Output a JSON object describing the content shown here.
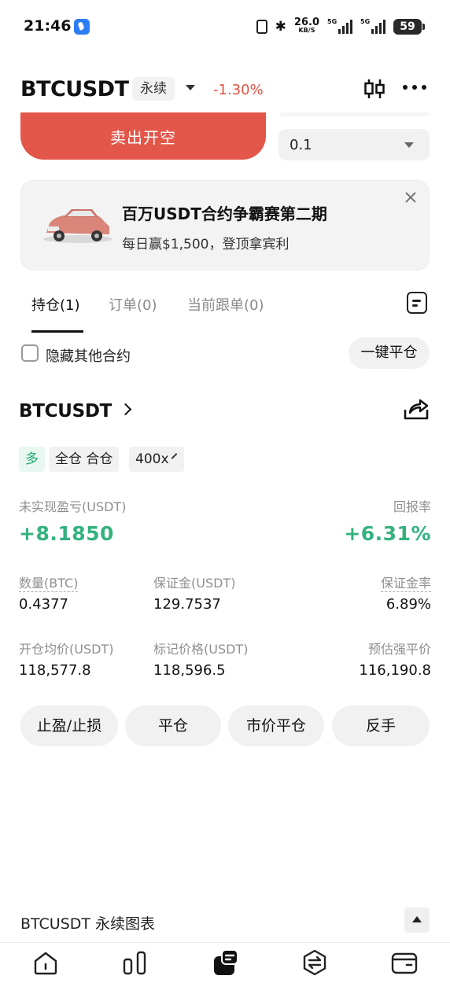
{
  "status_bar": {
    "time": "21:46",
    "net_speed_value": "26.0",
    "net_speed_unit": "KB/S",
    "sig1_type": "5G",
    "sig2_type": "5G",
    "battery": "59"
  },
  "header": {
    "symbol": "BTCUSDT",
    "contract_type": "永续",
    "change": "-1.30%"
  },
  "order": {
    "sell_label": "卖出开空",
    "quantity": "0.1"
  },
  "banner": {
    "title": "百万USDT合约争霸赛第二期",
    "subtitle": "每日赢$1,500，登顶拿宾利"
  },
  "tabs": [
    {
      "label": "持仓(1)"
    },
    {
      "label": "订单(0)"
    },
    {
      "label": "当前跟单(0)"
    }
  ],
  "filter": {
    "hide_others_label": "隐藏其他合约",
    "close_all_label": "一键平仓"
  },
  "position": {
    "symbol": "BTCUSDT",
    "side": "多",
    "margin_mode": "全仓 合仓",
    "leverage": "400x",
    "unrealized_pnl_label": "未实现盈亏(USDT)",
    "unrealized_pnl": "+8.1850",
    "roe_label": "回报率",
    "roe": "+6.31%",
    "size_label": "数量(BTC)",
    "size": "0.4377",
    "margin_label": "保证金(USDT)",
    "margin": "129.7537",
    "margin_ratio_label": "保证金率",
    "margin_ratio": "6.89%",
    "entry_label": "开仓均价(USDT)",
    "entry": "118,577.8",
    "mark_label": "标记价格(USDT)",
    "mark": "118,596.5",
    "liq_label": "预估强平价",
    "liq": "116,190.8",
    "actions": [
      "止盈/止损",
      "平仓",
      "市价平仓",
      "反手"
    ]
  },
  "chart_footer": {
    "label": "BTCUSDT 永续图表"
  },
  "colors": {
    "sell": "#e3574a",
    "gain": "#33b27e",
    "loss": "#e05243"
  },
  "bottom_nav": [
    "home-icon",
    "markets-icon",
    "trade-icon",
    "swap-icon",
    "wallet-icon"
  ]
}
